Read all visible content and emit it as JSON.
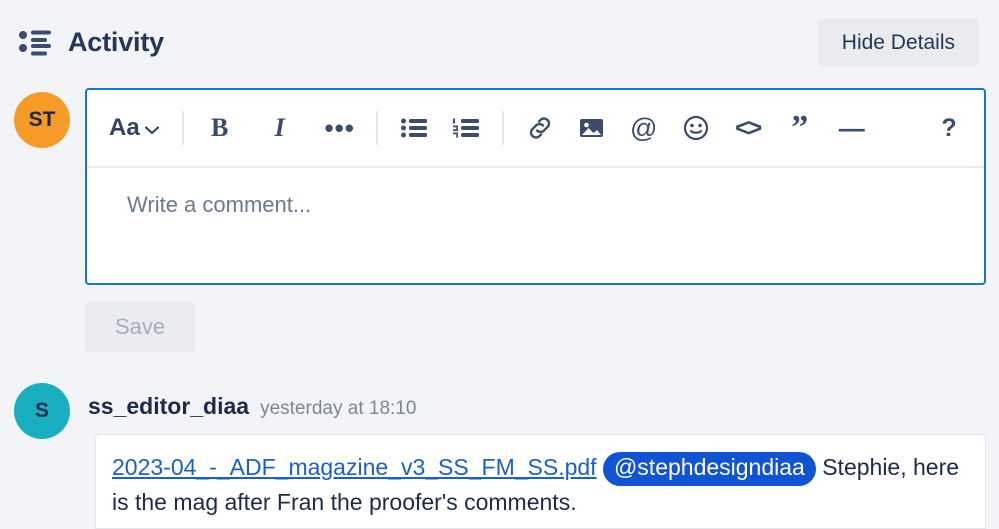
{
  "header": {
    "icon": "bulleted-list-icon",
    "title": "Activity",
    "hide_details_label": "Hide Details"
  },
  "composer": {
    "avatar_initials": "ST",
    "avatar_color": "#f79b28",
    "border_color": "#1578c2",
    "toolbar": {
      "font_style_label": "Aa",
      "chevron": "⌄",
      "bold": "B",
      "italic": "I",
      "more": "•••",
      "bullet_list": "bullet-list-icon",
      "numbered_list": "numbered-list-icon",
      "link": "link-icon",
      "image": "image-icon",
      "mention": "@",
      "emoji": "emoji-icon",
      "code": "<>",
      "quote": "”",
      "rule": "—",
      "help": "?"
    },
    "placeholder": "Write a comment...",
    "save_label": "Save",
    "save_enabled": false
  },
  "comment": {
    "avatar_initials": "S",
    "avatar_color": "#18b0c0",
    "author": "ss_editor_diaa",
    "timestamp": "yesterday at 18:10",
    "attachment_name": "2023-04_-_ADF_magazine_v3_SS_FM_SS.pdf",
    "mention": "@stephdesigndiaa",
    "text_after_mention": "Stephie,",
    "line_two": "here is the mag after Fran the proofer's comments.",
    "link_color": "#1a5fd0",
    "mention_color": "#1053d4"
  }
}
